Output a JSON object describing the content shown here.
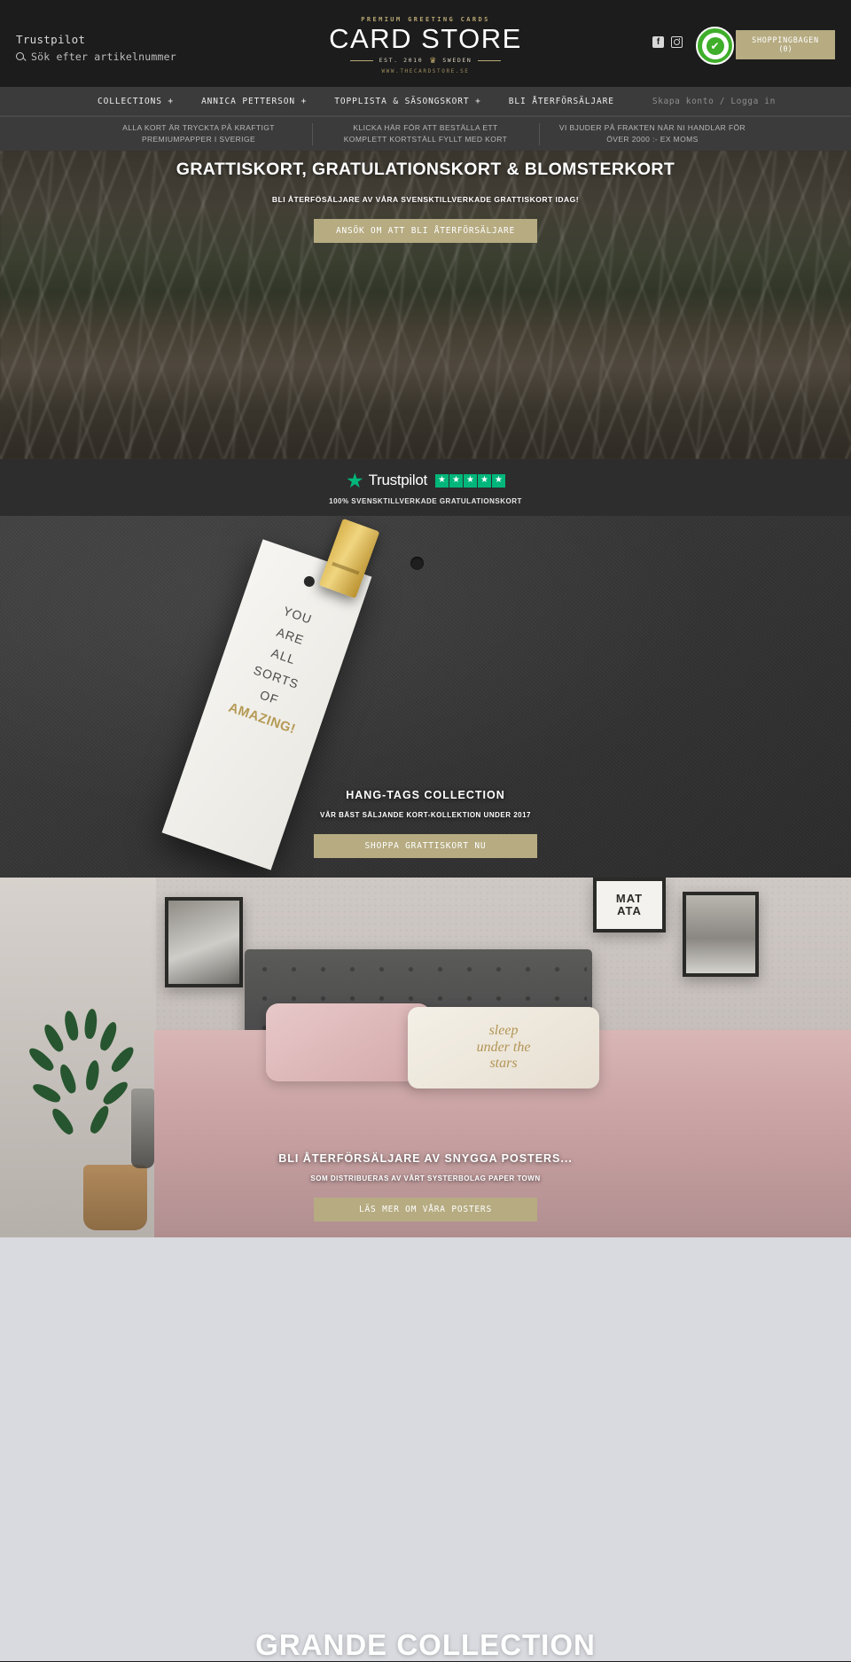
{
  "header": {
    "trustpilot_link": "Trustpilot",
    "search_placeholder": "Sök efter artikelnummer",
    "search_icon": "search-icon",
    "logo": {
      "kicker": "PREMIUM GREETING CARDS",
      "name": "CARD STORE",
      "est_left": "EST. 2010",
      "crown_icon": "crown-icon",
      "est_right": "SWEDEN",
      "url": "WWW.THECARDSTORE.SE"
    },
    "social": [
      {
        "name": "facebook-icon",
        "glyph": "f"
      },
      {
        "name": "instagram-icon",
        "glyph": ""
      }
    ],
    "trust_badge": {
      "name": "certified-badge-icon",
      "check_glyph": "✔"
    },
    "cart": {
      "label": "SHOPPINGBAGEN",
      "count": "(0)"
    }
  },
  "nav": {
    "items": [
      {
        "label": "COLLECTIONS +",
        "name": "nav-collections"
      },
      {
        "label": "ANNICA PETTERSON +",
        "name": "nav-annica-petterson"
      },
      {
        "label": "TOPPLISTA & SÄSONGSKORT +",
        "name": "nav-topplista-sasongskort"
      },
      {
        "label": "BLI ÅTERFÖRSÄLJARE",
        "name": "nav-bli-aterforsaljare"
      }
    ],
    "account": "Skapa konto / Logga in"
  },
  "usp": {
    "items": [
      "ALLA KORT ÄR TRYCKTA PÅ KRAFTIGT PREMIUMPAPPER I SVERIGE",
      "KLICKA HÄR FÖR ATT BESTÄLLA ETT KOMPLETT KORTSTÄLL FYLLT MED KORT",
      "VI BJUDER PÅ FRAKTEN NÄR NI HANDLAR FÖR ÖVER 2000 :- EX MOMS"
    ]
  },
  "hero": {
    "heading": "GRATTISKORT, GRATULATIONSKORT & BLOMSTERKORT",
    "subheading": "BLI ÅTERFÖSÄLJARE AV VÅRA SVENSKTILLVERKADE GRATTISKORT IDAG!",
    "button": "ANSÖK OM ATT BLI ÅTERFÖRSÄLJARE"
  },
  "trustpilot_strip": {
    "star_icon": "trustpilot-star-icon",
    "wordmark": "Trustpilot",
    "stars": [
      "★",
      "★",
      "★",
      "★",
      "★"
    ],
    "caption": "100% SVENSKTILLVERKADE GRATULATIONSKORT",
    "accent_color": "#00b67a"
  },
  "hang_tags": {
    "card_lines": [
      "YOU",
      "ARE",
      "ALL",
      "SORTS",
      "OF"
    ],
    "card_gold_line": "AMAZING!",
    "heading": "HANG-TAGS COLLECTION",
    "subheading": "VÅR BÄST SÄLJANDE KORT-KOLLEKTION UNDER 2017",
    "button": "SHOPPA GRATTISKORT NU"
  },
  "posters": {
    "frame_text_line1": "MAT",
    "frame_text_line2": "ATA",
    "pillow_text_line1": "sleep",
    "pillow_text_line2": "under the",
    "pillow_text_line3": "stars",
    "heading": "BLI ÅTERFÖRSÄLJARE AV SNYGGA POSTERS...",
    "subheading": "SOM DISTRIBUERAS AV VÅRT SYSTERBOLAG PAPER TOWN",
    "button": "LÄS MER OM VÅRA POSTERS"
  },
  "grande": {
    "heading": "GRANDE COLLECTION"
  },
  "colors": {
    "gold": "#b6ab81",
    "dark": "#1c1c1c",
    "nav": "#3b3b3b",
    "trustpilot_green": "#00b67a"
  }
}
